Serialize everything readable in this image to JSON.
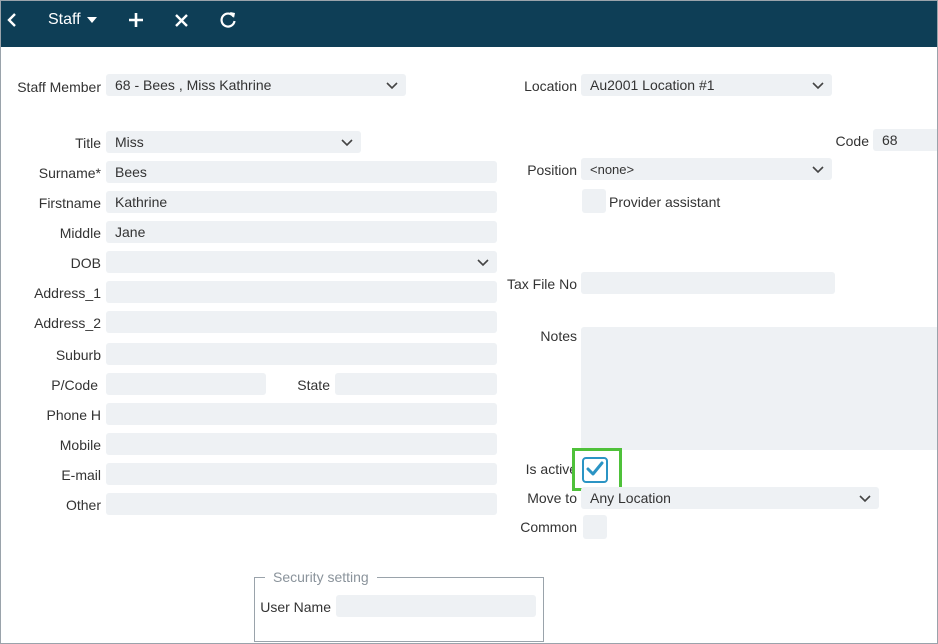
{
  "toolbar": {
    "title": "Staff",
    "icons": {
      "back": "chevron-left-icon",
      "menu": "caret-down-icon",
      "add": "plus-icon",
      "close": "close-icon",
      "refresh": "refresh-icon"
    }
  },
  "form": {
    "staff_member": {
      "label": "Staff Member",
      "value": "68 -  Bees , Miss Kathrine"
    },
    "title": {
      "label": "Title",
      "value": "Miss"
    },
    "surname": {
      "label": "Surname*",
      "value": "Bees"
    },
    "firstname": {
      "label": "Firstname",
      "value": "Kathrine"
    },
    "middle": {
      "label": "Middle",
      "value": "Jane"
    },
    "dob": {
      "label": "DOB",
      "value": ""
    },
    "address1": {
      "label": "Address_1",
      "value": ""
    },
    "address2": {
      "label": "Address_2",
      "value": ""
    },
    "suburb": {
      "label": "Suburb",
      "value": ""
    },
    "pcode": {
      "label": "P/Code",
      "value": ""
    },
    "state": {
      "label": "State",
      "value": ""
    },
    "phone_h": {
      "label": "Phone H",
      "value": ""
    },
    "mobile": {
      "label": "Mobile",
      "value": ""
    },
    "email": {
      "label": "E-mail",
      "value": ""
    },
    "other": {
      "label": "Other",
      "value": ""
    },
    "location": {
      "label": "Location",
      "value": "Au2001 Location #1"
    },
    "code": {
      "label": "Code",
      "value": "68"
    },
    "position": {
      "label": "Position",
      "value": "<none>"
    },
    "provider_assistant": {
      "label": "Provider assistant",
      "checked": false
    },
    "tax_file_no": {
      "label": "Tax File No",
      "value": ""
    },
    "notes": {
      "label": "Notes",
      "value": ""
    },
    "is_active": {
      "label": "Is active",
      "checked": true
    },
    "move_to": {
      "label": "Move to",
      "value": "Any Location"
    },
    "common": {
      "label": "Common",
      "checked": false
    }
  },
  "security": {
    "legend": "Security setting",
    "user_name": {
      "label": "User Name",
      "value": ""
    }
  },
  "colors": {
    "toolbar_bg": "#0e3e56",
    "field_bg": "#eef1f4",
    "highlight": "#4fc13a",
    "check": "#2b94c4"
  }
}
